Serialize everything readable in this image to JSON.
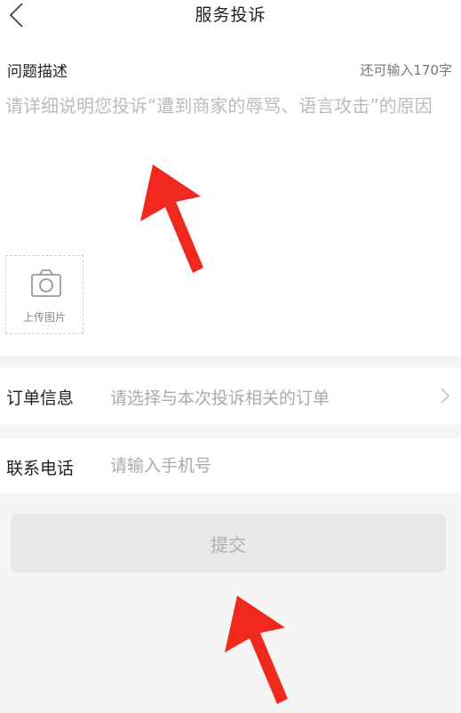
{
  "header": {
    "title": "服务投诉",
    "back_icon": "chevron-left-icon"
  },
  "description": {
    "label": "问题描述",
    "char_count": "还可输入170字",
    "placeholder": "请详细说明您投诉“遭到商家的辱骂、语言攻击”的原因",
    "value": ""
  },
  "upload": {
    "icon": "camera-icon",
    "label": "上传图片"
  },
  "order": {
    "label": "订单信息",
    "placeholder": "请选择与本次投诉相关的订单",
    "chevron_icon": "chevron-right-icon"
  },
  "phone": {
    "label": "联系电话",
    "placeholder": "请输入手机号",
    "value": ""
  },
  "submit": {
    "label": "提交"
  },
  "colors": {
    "background": "#f5f5f5",
    "card": "#ffffff",
    "placeholder": "#bbbbbb",
    "button_bg": "#e8e8e8",
    "button_text": "#b0b0b0",
    "annotation_arrow": "#f0281e"
  }
}
